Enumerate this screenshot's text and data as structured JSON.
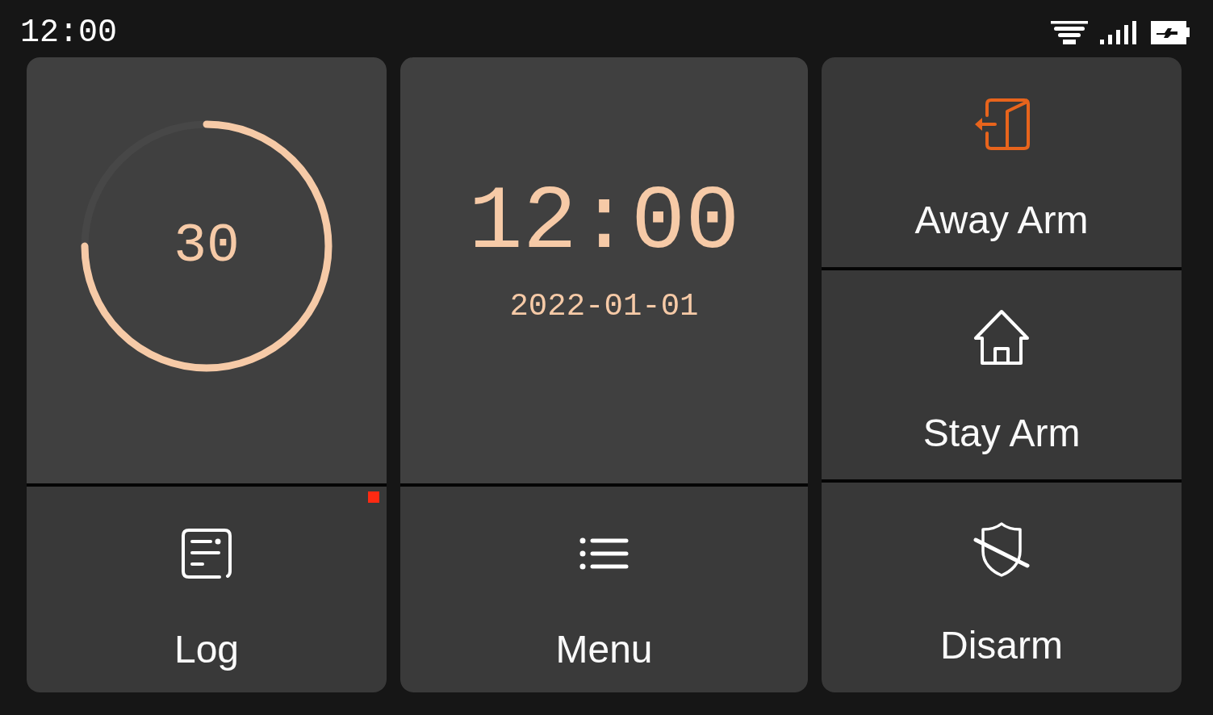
{
  "status_bar": {
    "time": "12:00"
  },
  "timer": {
    "value": "30",
    "level": 0.75
  },
  "clock": {
    "time": "12:00",
    "date": "2022-01-01"
  },
  "arm_modes": [
    {
      "kind": "away",
      "label": "Away Arm",
      "selected": true
    },
    {
      "kind": "stay",
      "label": "Stay Arm",
      "selected": false
    },
    {
      "kind": "disarm",
      "label": "Disarm",
      "selected": false
    }
  ],
  "shortcuts": [
    {
      "kind": "log",
      "label": "Log",
      "unread": true
    },
    {
      "kind": "menu",
      "label": "Menu",
      "unread": false
    }
  ]
}
